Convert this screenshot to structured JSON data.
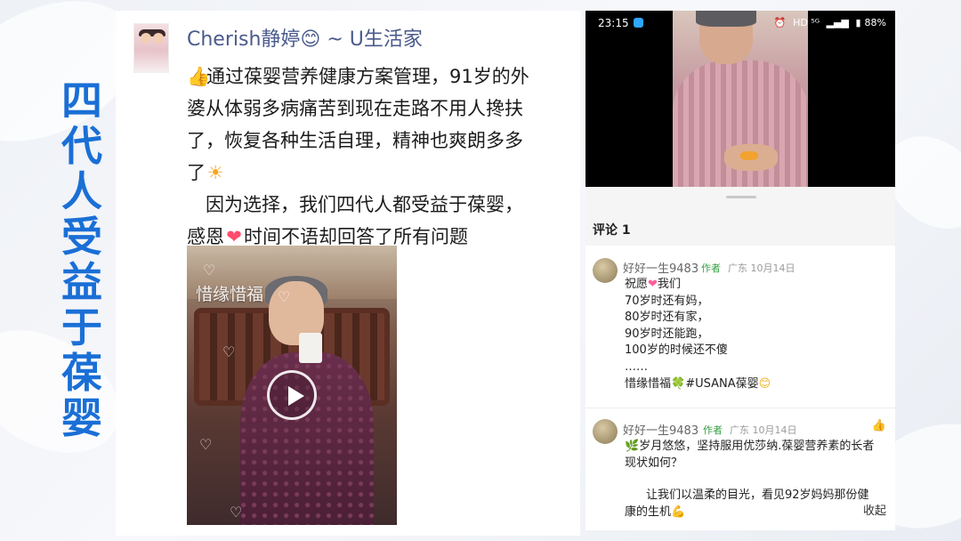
{
  "slide": {
    "side_title": "四代人受益于葆婴"
  },
  "post": {
    "username": "Cherish静婷😊 ~ U生活家",
    "text_lines": [
      "通过葆婴营养健康方案管理，91岁的外",
      "婆从体弱多病痛苦到现在走路不用人搀扶",
      "了，恢复各种生活自理，精神也爽朗多多",
      "了",
      "　因为选择，我们四代人都受益于葆婴，",
      "感恩",
      "时间不语却回答了所有问题"
    ],
    "video_watermark": "惜缘惜福",
    "icons": {
      "thumb": "thumbs-up-icon",
      "sun": "sun-icon",
      "heart": "heart-icon",
      "play": "play-icon"
    }
  },
  "phone": {
    "status": {
      "time": "23:15",
      "battery": "88%",
      "indicators": "HD ⁵ᴳ"
    },
    "comment_count_label": "评论 1",
    "comments": [
      {
        "name": "好好一生9483",
        "author_badge": "作者",
        "meta": "广东  10月14日",
        "lines": [
          "祝愿",
          "我们",
          "70岁时还有妈，",
          "80岁时还有家，",
          "90岁时还能跑，",
          "100岁的时候还不傻",
          "……",
          "惜缘惜福",
          "#USANA葆婴"
        ]
      },
      {
        "name": "好好一生9483",
        "author_badge": "作者",
        "meta": "广东  10月14日",
        "lines": [
          "岁月悠悠，坚持服用优莎纳.葆婴营养素的长者",
          "现状如何？",
          "让我们以温柔的目光，看见92岁妈妈那份健",
          "康的生机"
        ],
        "collapse_label": "收起"
      }
    ]
  }
}
